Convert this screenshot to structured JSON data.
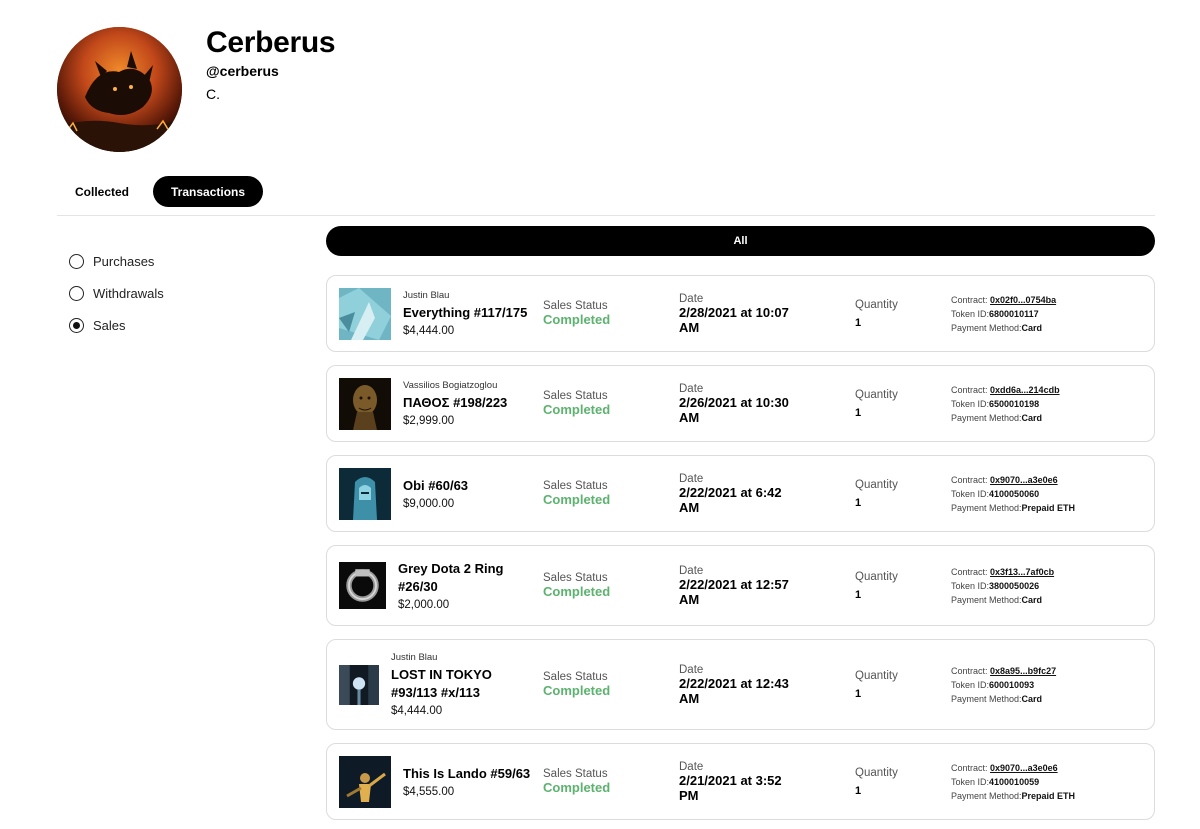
{
  "profile": {
    "name": "Cerberus",
    "handle": "@cerberus",
    "bio": "C."
  },
  "tabs": [
    {
      "label": "Collected"
    },
    {
      "label": "Transactions"
    }
  ],
  "filters": [
    {
      "label": "Purchases",
      "selected": false
    },
    {
      "label": "Withdrawals",
      "selected": false
    },
    {
      "label": "Sales",
      "selected": true
    }
  ],
  "all_label": "All",
  "labels": {
    "sales_status": "Sales Status",
    "date": "Date",
    "quantity": "Quantity",
    "contract": "Contract:",
    "token_id": "Token ID:",
    "payment_method": "Payment Method:"
  },
  "transactions": [
    {
      "artist": "Justin Blau",
      "title": "Everything #117/175",
      "price": "$4,444.00",
      "status": "Completed",
      "date": "2/28/2021 at 10:07 AM",
      "quantity": "1",
      "contract": "0x02f0...0754ba",
      "token_id": "6800010117",
      "payment_method": "Card"
    },
    {
      "artist": "Vassilios Bogiatzoglou",
      "title": "ΠΑΘΟΣ #198/223",
      "price": "$2,999.00",
      "status": "Completed",
      "date": "2/26/2021 at 10:30 AM",
      "quantity": "1",
      "contract": "0xdd6a...214cdb",
      "token_id": "6500010198",
      "payment_method": "Card"
    },
    {
      "artist": "",
      "title": "Obi #60/63",
      "price": "$9,000.00",
      "status": "Completed",
      "date": "2/22/2021 at 6:42 AM",
      "quantity": "1",
      "contract": "0x9070...a3e0e6",
      "token_id": "4100050060",
      "payment_method": "Prepaid ETH"
    },
    {
      "artist": "",
      "title": "Grey Dota 2 Ring #26/30",
      "price": "$2,000.00",
      "status": "Completed",
      "date": "2/22/2021 at 12:57 AM",
      "quantity": "1",
      "contract": "0x3f13...7af0cb",
      "token_id": "3800050026",
      "payment_method": "Card"
    },
    {
      "artist": "Justin Blau",
      "title": "LOST IN TOKYO #93/113 #x/113",
      "price": "$4,444.00",
      "status": "Completed",
      "date": "2/22/2021 at 12:43 AM",
      "quantity": "1",
      "contract": "0x8a95...b9fc27",
      "token_id": "600010093",
      "payment_method": "Card"
    },
    {
      "artist": "",
      "title": "This Is Lando #59/63",
      "price": "$4,555.00",
      "status": "Completed",
      "date": "2/21/2021 at 3:52 PM",
      "quantity": "1",
      "contract": "0x9070...a3e0e6",
      "token_id": "4100010059",
      "payment_method": "Prepaid ETH"
    }
  ]
}
